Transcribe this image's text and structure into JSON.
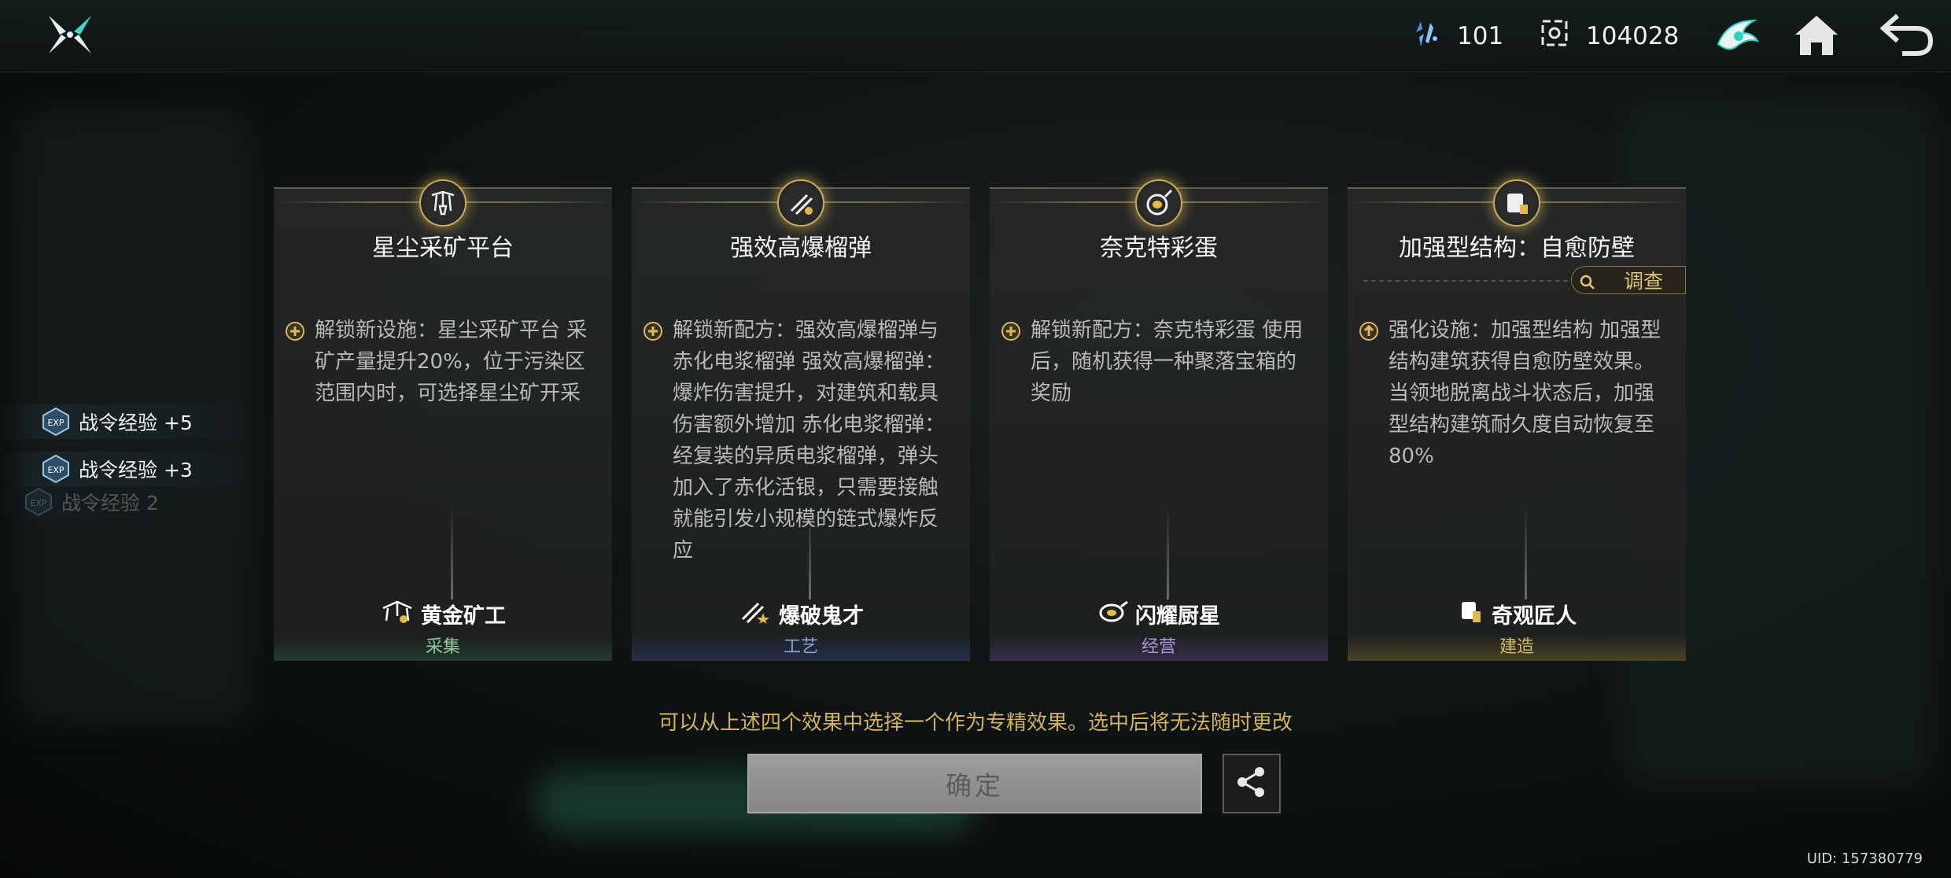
{
  "header": {
    "resource_1": {
      "icon": "crystal-shard-icon",
      "value": "101"
    },
    "resource_2": {
      "icon": "gear-box-icon",
      "value": "104028"
    },
    "icons": [
      "guild-emblem-icon",
      "home-icon",
      "back-arrow-icon"
    ]
  },
  "exp_list": [
    {
      "label": "战令经验 +5"
    },
    {
      "label": "战令经验 +3"
    },
    {
      "label": "战令经验 2"
    }
  ],
  "cards": [
    {
      "title": "星尘采矿平台",
      "emblem_icon": "mining-drill-icon",
      "desc_icon": "plus-circle-icon",
      "description": "解锁新设施：星尘采矿平台 采矿产量提升20%，位于污染区范围内时，可选择星尘矿开采",
      "role": "黄金矿工",
      "category": "采集"
    },
    {
      "title": "强效高爆榴弹",
      "emblem_icon": "grenade-wrench-icon",
      "desc_icon": "plus-circle-icon",
      "description": "解锁新配方：强效高爆榴弹与赤化电浆榴弹 强效高爆榴弹：爆炸伤害提升，对建筑和载具伤害额外增加 赤化电浆榴弹：经复装的异质电浆榴弹，弹头加入了赤化活银，只需要接触就能引发小规模的链式爆炸反应",
      "role": "爆破鬼才",
      "category": "工艺"
    },
    {
      "title": "奈克特彩蛋",
      "emblem_icon": "frying-pan-icon",
      "desc_icon": "plus-circle-icon",
      "description": "解锁新配方：奈克特彩蛋 使用后，随机获得一种聚落宝箱的奖励",
      "role": "闪耀厨星",
      "category": "经营"
    },
    {
      "title": "加强型结构：自愈防壁",
      "emblem_icon": "structure-block-icon",
      "desc_icon": "upgrade-arrow-icon",
      "description": "强化设施：加强型结构 加强型结构建筑获得自愈防壁效果。当领地脱离战斗状态后，加强型结构建筑耐久度自动恢复至80%",
      "role": "奇观匠人",
      "category": "建造",
      "inspect_label": "调查"
    }
  ],
  "hint": "可以从上述四个效果中选择一个作为专精效果。选中后将无法随时更改",
  "confirm_label": "确定",
  "share_icon": "share-icon",
  "uid": "UID: 157380779"
}
